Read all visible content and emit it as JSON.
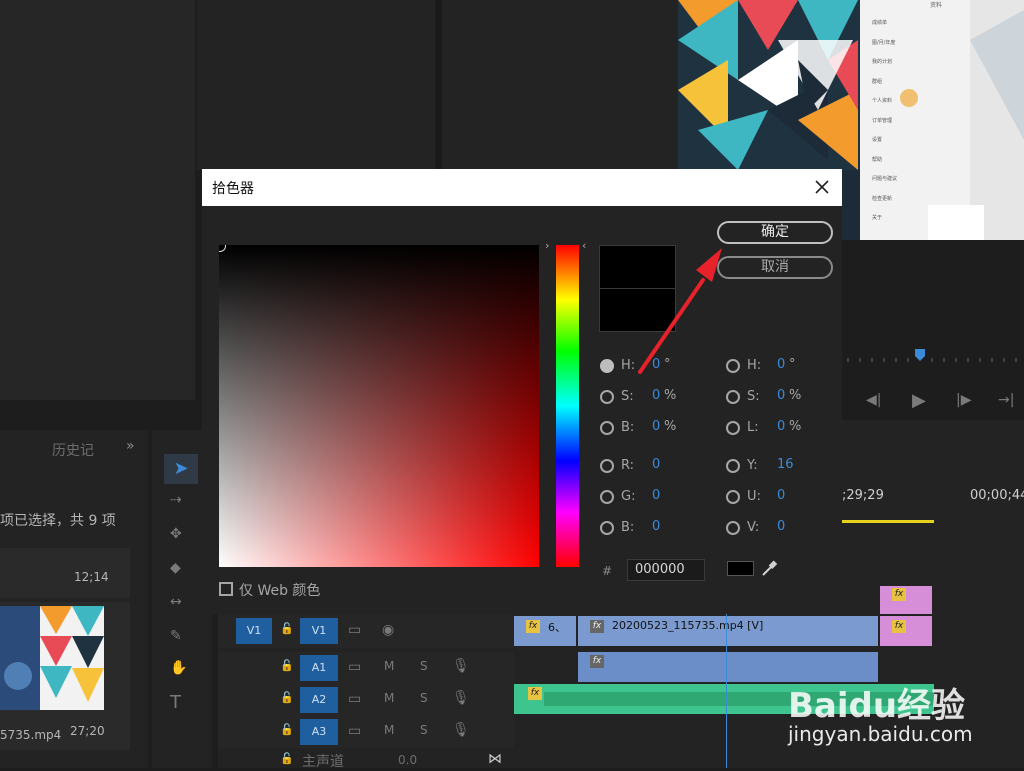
{
  "background": {
    "history_tab": "历史记",
    "project_status": "项已选择，共 9 项",
    "clip1_duration": "12;14",
    "clip2_duration": "27;20",
    "clip2_name": "5735.mp4",
    "timecode_mid": ";29;29",
    "timecode_right": "00;00;44",
    "tracks": [
      {
        "src": "V1",
        "dst": "V1"
      },
      {
        "src": "",
        "dst": "A1",
        "m": "M",
        "s": "S"
      },
      {
        "src": "",
        "dst": "A2",
        "m": "M",
        "s": "S"
      },
      {
        "src": "",
        "dst": "A3",
        "m": "M",
        "s": "S"
      }
    ],
    "master_label": "主声道",
    "master_value": "0.0",
    "clip_label_small": "6、",
    "video_clip_name": "20200523_115735.mp4 [V]",
    "phone_menu": [
      "成绩单",
      "图/月/年度",
      "我的计划",
      "群组",
      "个人资料",
      "订单管理",
      "设置",
      "帮助",
      "问题与建议",
      "检查更新",
      "关于"
    ],
    "phone_header": "资料"
  },
  "dialog": {
    "title": "拾色器",
    "ok_label": "确定",
    "cancel_label": "取消",
    "web_colors_label": "仅 Web 颜色",
    "hex_prefix": "#",
    "hex_value": "000000",
    "fields_left": [
      {
        "label": "H:",
        "value": "0",
        "unit": "°"
      },
      {
        "label": "S:",
        "value": "0",
        "unit": "%"
      },
      {
        "label": "B:",
        "value": "0",
        "unit": "%"
      },
      {
        "label": "R:",
        "value": "0",
        "unit": ""
      },
      {
        "label": "G:",
        "value": "0",
        "unit": ""
      },
      {
        "label": "B:",
        "value": "0",
        "unit": ""
      }
    ],
    "fields_right": [
      {
        "label": "H:",
        "value": "0",
        "unit": "°"
      },
      {
        "label": "S:",
        "value": "0",
        "unit": "%"
      },
      {
        "label": "L:",
        "value": "0",
        "unit": "%"
      },
      {
        "label": "Y:",
        "value": "16",
        "unit": ""
      },
      {
        "label": "U:",
        "value": "0",
        "unit": ""
      },
      {
        "label": "V:",
        "value": "0",
        "unit": ""
      }
    ],
    "current_color": "#000000"
  },
  "watermark": {
    "brand": "Baidu经验",
    "url": "jingyan.baidu.com"
  },
  "colors": {
    "accent_blue": "#3c8bd8",
    "track_blue": "#1f5fa0",
    "video_clip": "#7b9bd0",
    "fx_clip": "#d78ed8",
    "audio_clip": "#3ec48f",
    "annotation_arrow": "#e8222a"
  }
}
